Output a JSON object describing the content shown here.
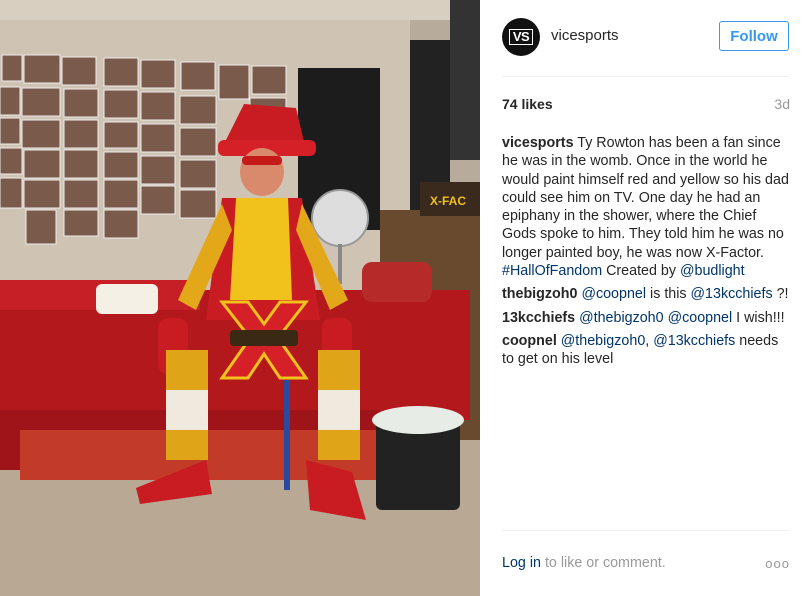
{
  "post": {
    "username": "vicesports",
    "avatar_text": "VS",
    "follow_label": "Follow",
    "likes": "74 likes",
    "time": "3d",
    "caption_user": "vicesports",
    "caption_text": " Ty Rowton has been a fan since he was in the womb. Once in the world he would paint himself red and yellow so his dad could see him on TV. One day he had an epiphany in the shower, where the Chief Gods spoke to him. They told him he was no longer painted boy, he was now X-Factor. ",
    "caption_hashtag": "#HallOfFandom",
    "caption_text2": " Created by ",
    "caption_mention": "@budlight",
    "photo_sign_text": "X-FAC"
  },
  "comments": [
    {
      "user": "thebigzoh0",
      "parts": [
        {
          "t": " "
        },
        {
          "link": "@coopnel"
        },
        {
          "t": " is this "
        },
        {
          "link": "@13kcchiefs"
        },
        {
          "t": " ?!"
        }
      ]
    },
    {
      "user": "13kcchiefs",
      "parts": [
        {
          "t": " "
        },
        {
          "link": "@thebigzoh0"
        },
        {
          "t": " "
        },
        {
          "link": "@coopnel"
        },
        {
          "t": " I wish!!!"
        }
      ]
    },
    {
      "user": "coopnel",
      "parts": [
        {
          "t": " "
        },
        {
          "link": "@thebigzoh0"
        },
        {
          "t": ", "
        },
        {
          "link": "@13kcchiefs"
        },
        {
          "t": " needs to get on his level"
        }
      ]
    }
  ],
  "footer": {
    "login_label": "Log in",
    "rest_label": " to like or comment.",
    "more_label": "ooo"
  },
  "colors": {
    "accent": "#3897f0",
    "link": "#003569"
  }
}
